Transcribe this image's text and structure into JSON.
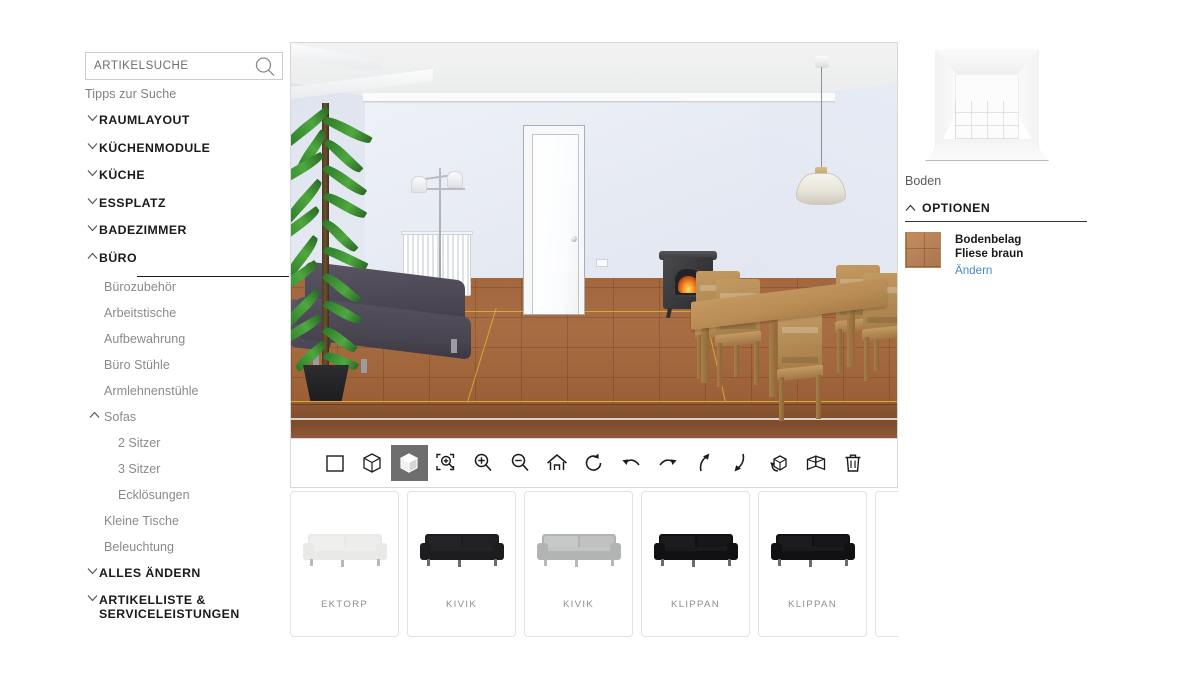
{
  "search": {
    "placeholder": "ARTIKELSUCHE",
    "value": "",
    "icon": "search-icon",
    "tips_label": "Tipps zur Suche"
  },
  "sidebar": {
    "items": [
      {
        "label": "RAUMLAYOUT",
        "level": 0,
        "chevron": "down",
        "state": "collapsed"
      },
      {
        "label": "KÜCHENMODULE",
        "level": 0,
        "chevron": "down",
        "state": "collapsed"
      },
      {
        "label": "KÜCHE",
        "level": 0,
        "chevron": "down",
        "state": "collapsed"
      },
      {
        "label": "ESSPLATZ",
        "level": 0,
        "chevron": "down",
        "state": "collapsed"
      },
      {
        "label": "BADEZIMMER",
        "level": 0,
        "chevron": "down",
        "state": "collapsed"
      },
      {
        "label": "BÜRO",
        "level": 0,
        "chevron": "up",
        "state": "expanded"
      },
      {
        "label": "Bürozubehör",
        "level": 1,
        "chevron": "none",
        "state": "normal"
      },
      {
        "label": "Arbeitstische",
        "level": 1,
        "chevron": "none",
        "state": "normal"
      },
      {
        "label": "Aufbewahrung",
        "level": 1,
        "chevron": "none",
        "state": "normal"
      },
      {
        "label": "Büro Stühle",
        "level": 1,
        "chevron": "none",
        "state": "normal"
      },
      {
        "label": "Armlehnenstühle",
        "level": 1,
        "chevron": "none",
        "state": "normal"
      },
      {
        "label": "Sofas",
        "level": 1,
        "chevron": "up",
        "state": "expanded"
      },
      {
        "label": "2 Sitzer",
        "level": 2,
        "chevron": "none",
        "state": "selected"
      },
      {
        "label": "3 Sitzer",
        "level": 2,
        "chevron": "none",
        "state": "normal"
      },
      {
        "label": "Ecklösungen",
        "level": 2,
        "chevron": "none",
        "state": "normal"
      },
      {
        "label": "Kleine Tische",
        "level": 1,
        "chevron": "none",
        "state": "normal"
      },
      {
        "label": "Beleuchtung",
        "level": 1,
        "chevron": "none",
        "state": "normal"
      },
      {
        "label": "ALLES ÄNDERN",
        "level": 0,
        "chevron": "down",
        "state": "collapsed"
      },
      {
        "label": "ARTIKELLISTE &\nSERVICELEISTUNGEN",
        "level": 0,
        "chevron": "down",
        "state": "collapsed"
      }
    ]
  },
  "toolbar": {
    "buttons": [
      {
        "name": "view-2d-plan-button",
        "icon": "square-icon",
        "selected": false
      },
      {
        "name": "view-3d-wire-button",
        "icon": "cube-outline-icon",
        "selected": false
      },
      {
        "name": "view-3d-solid-button",
        "icon": "cube-solid-icon",
        "selected": true
      },
      {
        "name": "zoom-to-fit-button",
        "icon": "zoom-fit-icon",
        "selected": false
      },
      {
        "name": "zoom-in-button",
        "icon": "magnifier-plus-icon",
        "selected": false
      },
      {
        "name": "zoom-out-button",
        "icon": "magnifier-minus-icon",
        "selected": false
      },
      {
        "name": "home-view-button",
        "icon": "home-icon",
        "selected": false
      },
      {
        "name": "reset-rotate-button",
        "icon": "rotate-ccw-icon",
        "selected": false
      },
      {
        "name": "pan-left-button",
        "icon": "arrow-curve-left-icon",
        "selected": false
      },
      {
        "name": "pan-right-button",
        "icon": "arrow-curve-right-icon",
        "selected": false
      },
      {
        "name": "tilt-up-button",
        "icon": "arrow-up-curve-icon",
        "selected": false
      },
      {
        "name": "tilt-down-button",
        "icon": "arrow-down-curve-icon",
        "selected": false
      },
      {
        "name": "orbit-object-button",
        "icon": "cube-rotate-icon",
        "selected": false
      },
      {
        "name": "walls-toggle-button",
        "icon": "walls-icon",
        "selected": false
      },
      {
        "name": "delete-button",
        "icon": "trash-icon",
        "selected": false
      }
    ]
  },
  "carousel": {
    "items": [
      {
        "label": "EKTORP",
        "color": "#e9e9e7"
      },
      {
        "label": "KIVIK",
        "color": "#1d1d1f"
      },
      {
        "label": "KIVIK",
        "color": "#b2b4b3"
      },
      {
        "label": "KLIPPAN",
        "color": "#111113"
      },
      {
        "label": "KLIPPAN",
        "color": "#111113"
      },
      {
        "label": "",
        "color": "#ffffff"
      }
    ]
  },
  "right_panel": {
    "preview_caption": "Boden",
    "options_header": "OPTIONEN",
    "options_chevron": "up",
    "option": {
      "title": "Bodenbelag",
      "subtitle": "Fliese braun",
      "change_link": "Ändern",
      "swatch_color": "#b9835a",
      "link_color": "#4a86c8"
    }
  },
  "viewport": {
    "mode": "3D",
    "grid_color": "#d8b234",
    "floor_color": "#a2673f",
    "wall_color": "#e6eaf3"
  }
}
